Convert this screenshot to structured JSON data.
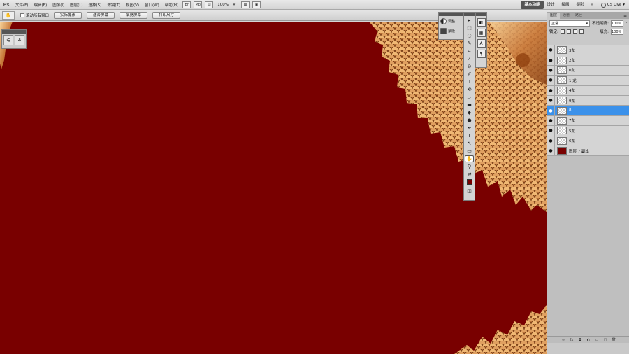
{
  "menubar": {
    "logo": "Ps",
    "items": [
      "文件(F)",
      "编辑(E)",
      "图像(I)",
      "图层(L)",
      "选择(S)",
      "滤镜(T)",
      "视图(V)",
      "窗口(W)",
      "帮助(H)"
    ],
    "zoom": "100%",
    "workspace": {
      "active": "基本功能",
      "others": [
        "设计",
        "绘画",
        "摄影",
        "»"
      ],
      "cslive": "CS Live"
    }
  },
  "options": {
    "scroll_all": "滚动所有窗口",
    "buttons": [
      "实际像素",
      "适合屏幕",
      "填充屏幕",
      "打印尺寸"
    ]
  },
  "adjust_panel": {
    "items": [
      {
        "label": "调整",
        "icon": "adjustments-icon"
      },
      {
        "label": "蒙版",
        "icon": "masks-icon"
      }
    ]
  },
  "layers_panel": {
    "tabs": [
      "图层",
      "通道",
      "路径"
    ],
    "active_tab": "图层",
    "blend_mode": "正常",
    "opacity_label": "不透明度:",
    "opacity": "100%",
    "lock_label": "锁定:",
    "fill_label": "填充:",
    "fill": "100%",
    "layers": [
      {
        "name": "3龙",
        "selected": false,
        "thumb": "transparent"
      },
      {
        "name": "2龙",
        "selected": false,
        "thumb": "transparent"
      },
      {
        "name": "0龙",
        "selected": false,
        "thumb": "transparent"
      },
      {
        "name": "1 龙",
        "selected": false,
        "thumb": "transparent"
      },
      {
        "name": "4龙",
        "selected": false,
        "thumb": "transparent"
      },
      {
        "name": "9龙",
        "selected": false,
        "thumb": "transparent"
      },
      {
        "name": "8",
        "selected": true,
        "thumb": "transparent"
      },
      {
        "name": "7龙",
        "selected": false,
        "thumb": "transparent"
      },
      {
        "name": "5龙",
        "selected": false,
        "thumb": "transparent"
      },
      {
        "name": "6龙",
        "selected": false,
        "thumb": "transparent"
      },
      {
        "name": "图层 7 副本",
        "selected": false,
        "thumb": "red"
      }
    ]
  },
  "colors": {
    "canvas": "#790000",
    "dragon_gold": "#d9904a",
    "selection": "#3b91ea",
    "foreground": "#790000"
  }
}
